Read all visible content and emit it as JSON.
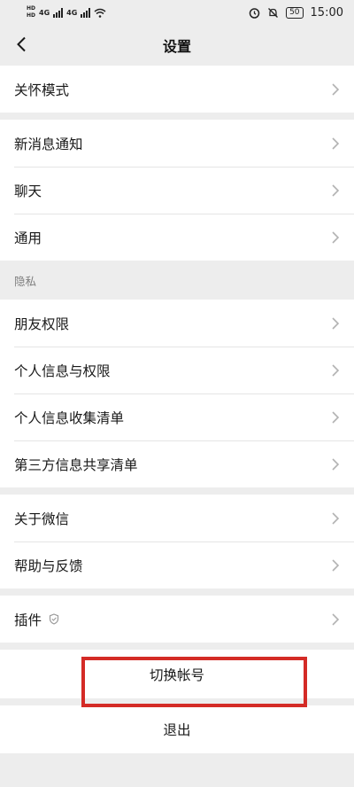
{
  "status_bar": {
    "time": "15:00",
    "battery": "50",
    "network_left": "4G",
    "network_right": "4G",
    "hd_label": "HD"
  },
  "header": {
    "title": "设置"
  },
  "groups": [
    {
      "items": [
        {
          "label": "关怀模式"
        }
      ]
    },
    {
      "items": [
        {
          "label": "新消息通知"
        },
        {
          "label": "聊天"
        },
        {
          "label": "通用"
        }
      ]
    }
  ],
  "privacy": {
    "section_label": "隐私",
    "items": [
      {
        "label": "朋友权限"
      },
      {
        "label": "个人信息与权限"
      },
      {
        "label": "个人信息收集清单"
      },
      {
        "label": "第三方信息共享清单"
      }
    ]
  },
  "about": {
    "items": [
      {
        "label": "关于微信"
      },
      {
        "label": "帮助与反馈"
      }
    ]
  },
  "plugins": {
    "label": "插件"
  },
  "switch_account": {
    "label": "切换帐号"
  },
  "logout": {
    "label": "退出"
  },
  "colors": {
    "background": "#ededed",
    "card": "#ffffff",
    "highlight_border": "#d42b26"
  }
}
